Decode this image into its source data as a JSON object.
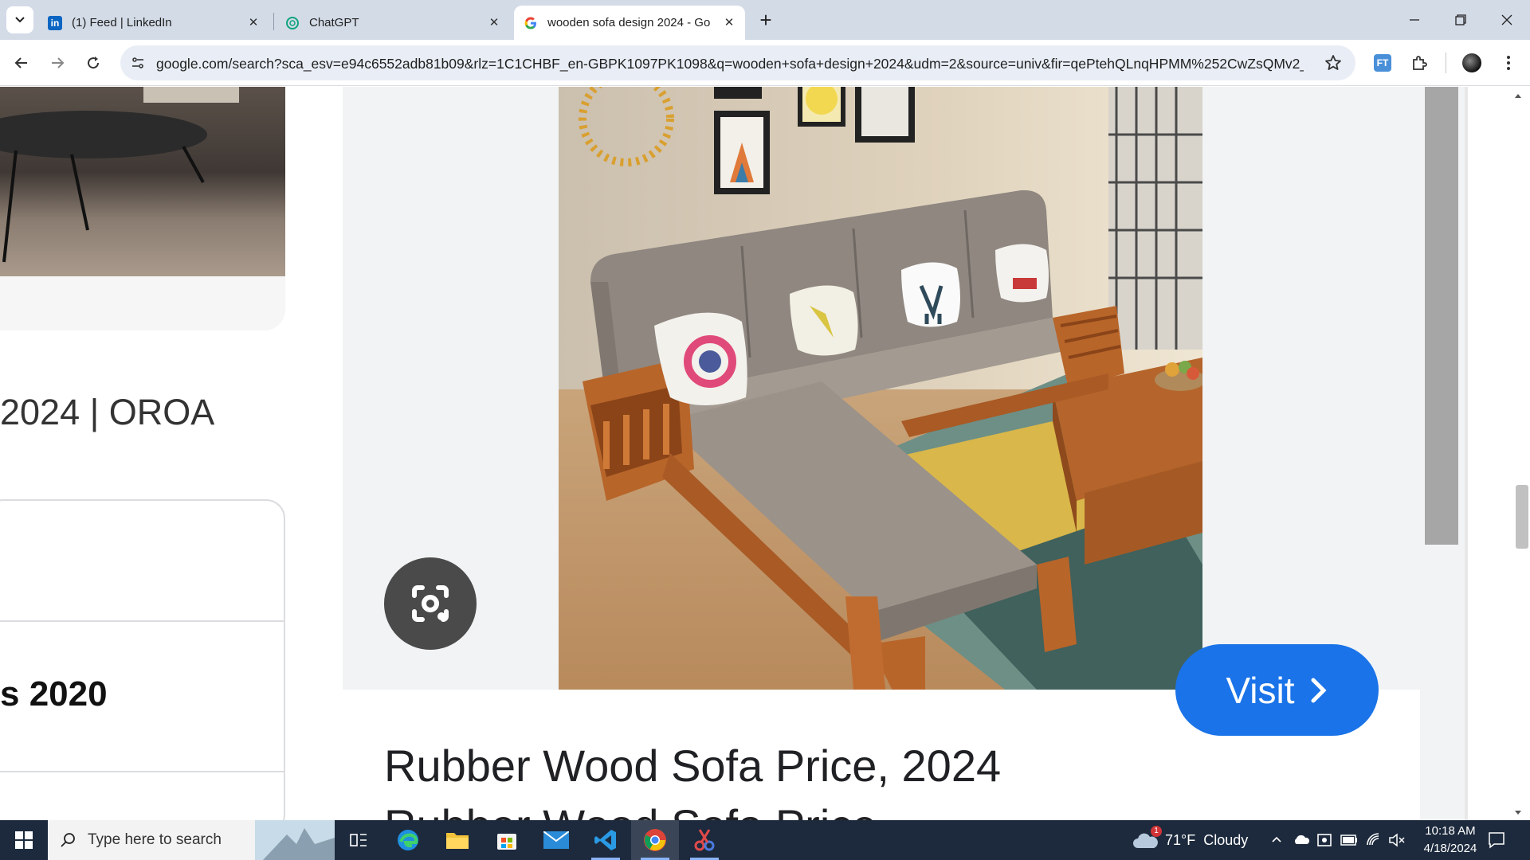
{
  "browser": {
    "tabs": [
      {
        "title": "(1) Feed | LinkedIn",
        "icon": "linkedin-icon"
      },
      {
        "title": "ChatGPT",
        "icon": "chatgpt-icon"
      },
      {
        "title": "wooden sofa design 2024 - Go",
        "icon": "google-icon",
        "active": true
      }
    ],
    "new_tab_label": "+",
    "url": "google.com/search?sca_esv=e94c6552adb81b09&rlz=1C1CHBF_en-GBPK1097PK1098&q=wooden+sofa+design+2024&udm=2&source=univ&fir=qePtehQLnqHPMM%252CwZsQMv2_c..."
  },
  "left_column": {
    "result_title_fragment": "2024 | OROA",
    "card_title_fragment": "s 2020"
  },
  "preview": {
    "title_line1": "Rubber Wood Sofa Price, 2024",
    "title_line2": "Rubber Wood Sofa Price",
    "visit_label": "Visit"
  },
  "taskbar": {
    "search_placeholder": "Type here to search",
    "weather": "71°F  Cloudy",
    "weather_badge": "1",
    "time": "10:18 AM",
    "date": "4/18/2024"
  },
  "colors": {
    "accent": "#1a73e8",
    "tabstrip": "#d3dbe7",
    "taskbar": "#1d2a3d"
  }
}
